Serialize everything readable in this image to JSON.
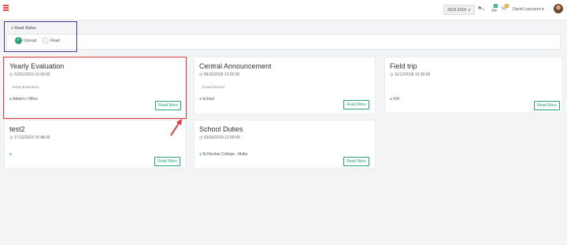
{
  "header": {
    "year": "2018-2019",
    "notifications_count": "2",
    "messages_count": "0",
    "user_name": "David Lancuzzo"
  },
  "filter": {
    "label": "Read Status",
    "options": [
      "Unread",
      "Read"
    ],
    "selected": "Unread"
  },
  "cards": [
    {
      "title": "Yearly Evaluation",
      "date": "21/01/2019 16:30:00",
      "description": "Yearly Evaluation",
      "location": "Admin's Office",
      "button": "Read More"
    },
    {
      "title": "Central Announcement",
      "date": "09/11/2018 12:02:00",
      "description": "Closed School",
      "location": "School",
      "button": "Read More"
    },
    {
      "title": "Field trip",
      "date": "11/12/2018 10:39:00",
      "description": "",
      "location": "XW",
      "button": "Read More"
    },
    {
      "title": "test2",
      "date": "17/12/2018 15:48:00",
      "description": "",
      "location": "",
      "button": "Read More"
    },
    {
      "title": "School Duties",
      "date": "03/03/2018 12:00:00",
      "description": "",
      "location": "St.Nicolas College , Malta",
      "button": "Read More"
    }
  ],
  "colors": {
    "accent": "#26a37a",
    "highlight_purple": "#5a2d91",
    "highlight_red": "#e0383a"
  }
}
